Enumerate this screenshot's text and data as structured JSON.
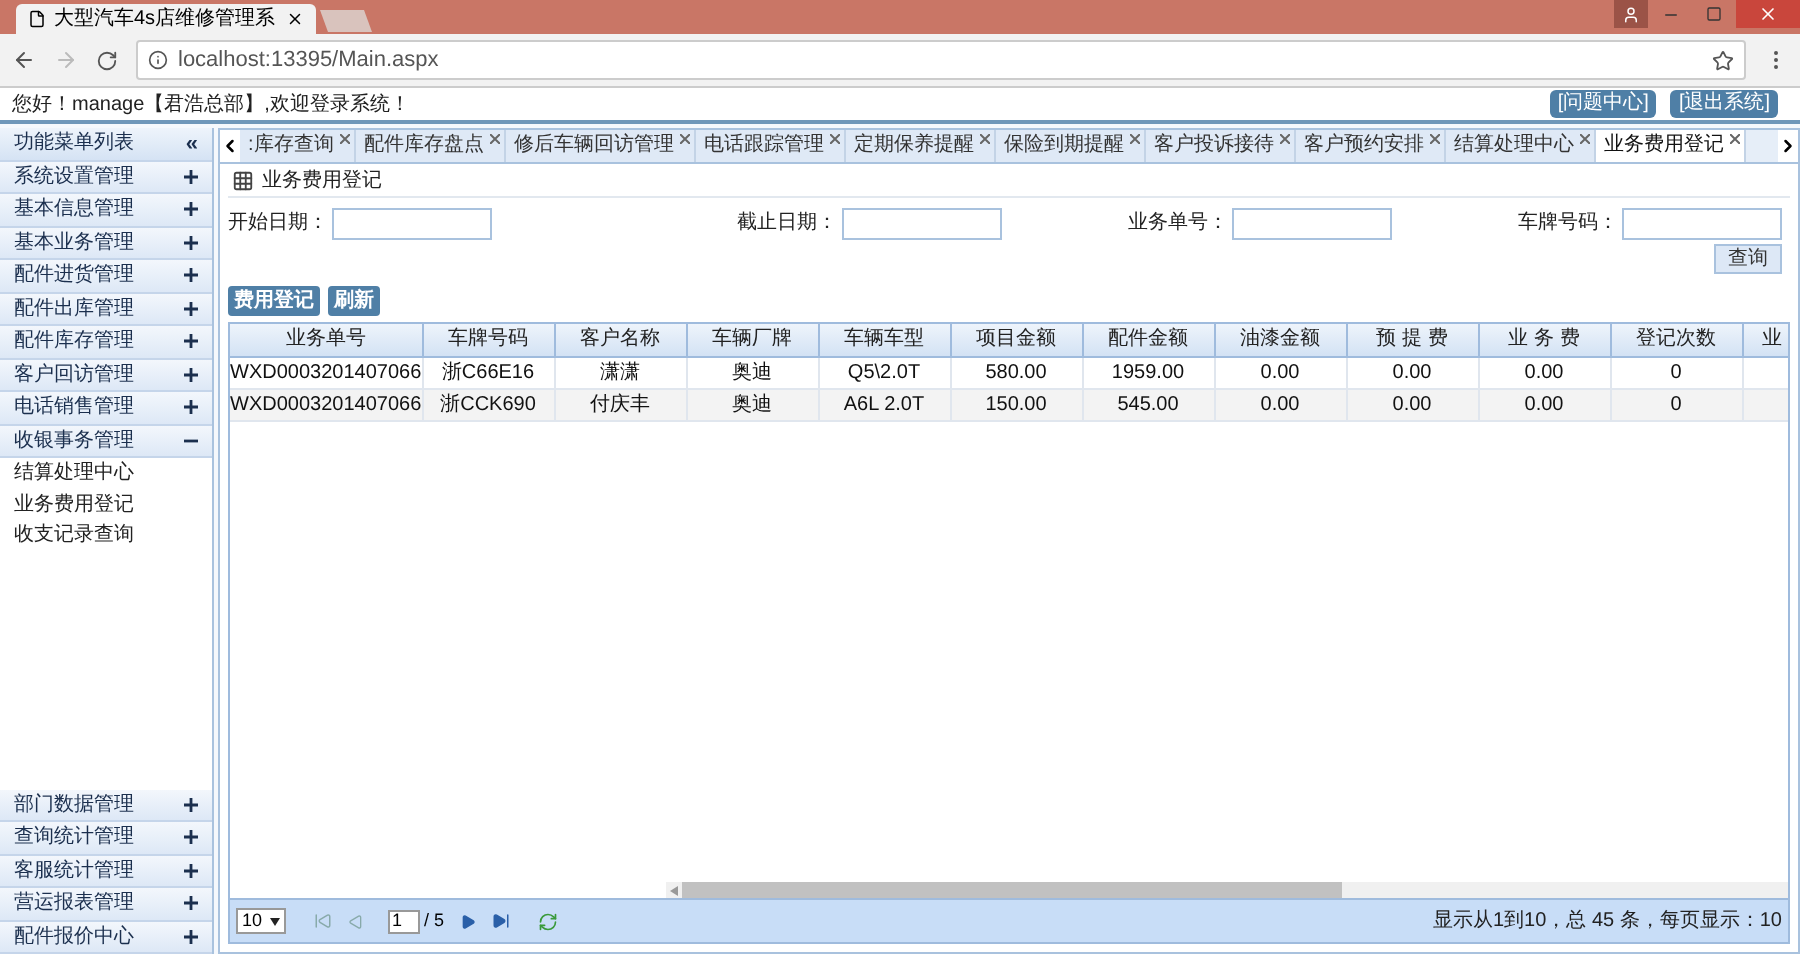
{
  "browser": {
    "tab_title": "大型汽车4s店维修管理系",
    "address": "localhost:13395/Main.aspx"
  },
  "header": {
    "greeting": "您好！manage【君浩总部】,欢迎登录系统！",
    "buttons": [
      "[问题中心]",
      "[退出系统]"
    ]
  },
  "sidebar": {
    "title": "功能菜单列表",
    "collapse": "«",
    "items": [
      {
        "label": "系统设置管理",
        "expanded": false
      },
      {
        "label": "基本信息管理",
        "expanded": false
      },
      {
        "label": "基本业务管理",
        "expanded": false
      },
      {
        "label": "配件进货管理",
        "expanded": false
      },
      {
        "label": "配件出库管理",
        "expanded": false
      },
      {
        "label": "配件库存管理",
        "expanded": false
      },
      {
        "label": "客户回访管理",
        "expanded": false
      },
      {
        "label": "电话销售管理",
        "expanded": false
      },
      {
        "label": "收银事务管理",
        "expanded": true,
        "children": [
          {
            "label": "结算处理中心"
          },
          {
            "label": "业务费用登记"
          },
          {
            "label": "收支记录查询"
          }
        ]
      }
    ],
    "bottom_items": [
      {
        "label": "部门数据管理",
        "expanded": false
      },
      {
        "label": "查询统计管理",
        "expanded": false
      },
      {
        "label": "客服统计管理",
        "expanded": false
      },
      {
        "label": "营运报表管理",
        "expanded": false
      },
      {
        "label": "配件报价中心",
        "expanded": false
      }
    ]
  },
  "tabs": [
    {
      "label": ":库存查询",
      "selected": false
    },
    {
      "label": "配件库存盘点",
      "selected": false
    },
    {
      "label": "修后车辆回访管理",
      "selected": false
    },
    {
      "label": "电话跟踪管理",
      "selected": false
    },
    {
      "label": "定期保养提醒",
      "selected": false
    },
    {
      "label": "保险到期提醒",
      "selected": false
    },
    {
      "label": "客户投诉接待",
      "selected": false
    },
    {
      "label": "客户预约安排",
      "selected": false
    },
    {
      "label": "结算处理中心",
      "selected": false
    },
    {
      "label": "业务费用登记",
      "selected": true
    }
  ],
  "panel": {
    "title": "业务费用登记",
    "filters": [
      {
        "label": "开始日期："
      },
      {
        "label": "截止日期："
      },
      {
        "label": "业务单号："
      },
      {
        "label": "车牌号码："
      }
    ],
    "query_button": "查询",
    "actions": [
      "费用登记",
      "刷新"
    ],
    "table": {
      "columns": [
        "业务单号",
        "车牌号码",
        "客户名称",
        "车辆厂牌",
        "车辆车型",
        "项目金额",
        "配件金额",
        "油漆金额",
        "预 提 费",
        "业 务 费",
        "登记次数",
        "业"
      ],
      "rows": [
        [
          "WXD0003201407066",
          "浙C66E16",
          "潇潇",
          "奥迪",
          "Q5\\2.0T",
          "580.00",
          "1959.00",
          "0.00",
          "0.00",
          "0.00",
          "0"
        ],
        [
          "WXD0003201407066",
          "浙CCK690",
          "付庆丰",
          "奥迪",
          "A6L 2.0T",
          "150.00",
          "545.00",
          "0.00",
          "0.00",
          "0.00",
          "0"
        ]
      ]
    },
    "pager": {
      "page_size": "10",
      "page": "1",
      "total_pages": "/ 5",
      "summary": "显示从1到10，总 45 条，每页显示：10"
    }
  }
}
